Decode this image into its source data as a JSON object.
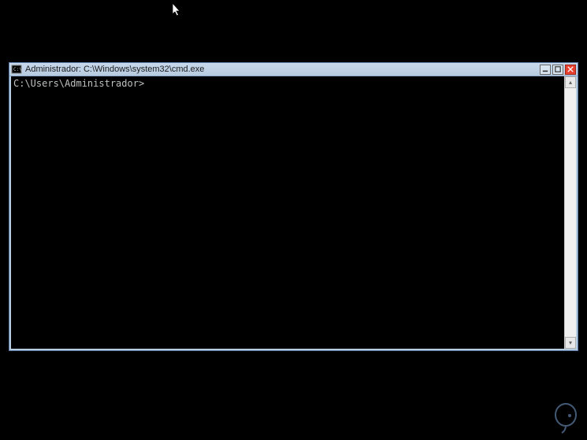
{
  "window": {
    "title": "Administrador: C:\\Windows\\system32\\cmd.exe"
  },
  "console": {
    "prompt": "C:\\Users\\Administrador>"
  },
  "controls": {
    "minimize": "_",
    "maximize": "□",
    "close": "×"
  },
  "scroll": {
    "up": "▴",
    "down": "▾"
  }
}
